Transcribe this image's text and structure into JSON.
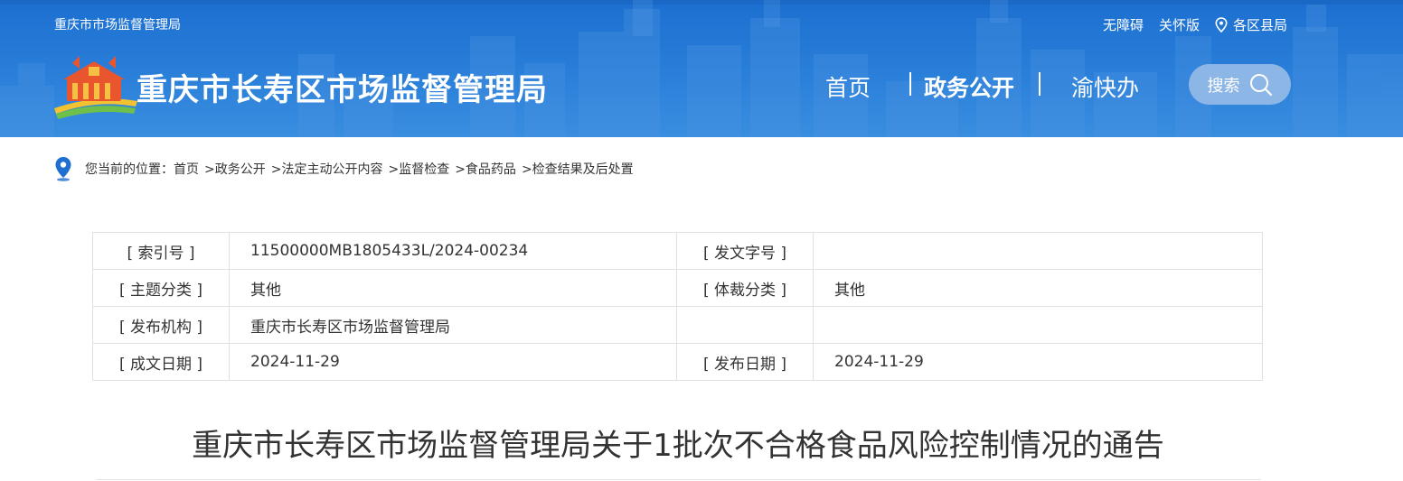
{
  "header": {
    "org_top": "重庆市市场监督管理局",
    "accessibility": "无障碍",
    "care_mode": "关怀版",
    "districts": "各区县局",
    "site_title": "重庆市长寿区市场监督管理局",
    "nav": {
      "home": "首页",
      "gov_open": "政务公开",
      "yu_kuai_ban": "渝快办"
    },
    "search_label": "搜索",
    "colors": {
      "banner": "#2a7fd9",
      "search_bg": "#8cb6e6"
    }
  },
  "breadcrumb": {
    "prefix": "您当前的位置：",
    "items": [
      "首页",
      ">政务公开",
      ">法定主动公开内容",
      ">监督检查",
      ">食品药品",
      ">检查结果及后处置"
    ]
  },
  "meta": {
    "rows": [
      {
        "l1": "[ 索引号 ]",
        "v1": "11500000MB1805433L/2024-00234",
        "l2": "[ 发文字号 ]",
        "v2": ""
      },
      {
        "l1": "[ 主题分类 ]",
        "v1": "其他",
        "l2": "[ 体裁分类 ]",
        "v2": "其他"
      },
      {
        "l1": "[ 发布机构 ]",
        "v1": "重庆市长寿区市场监督管理局",
        "l2": "",
        "v2": ""
      },
      {
        "l1": "[ 成文日期 ]",
        "v1": "2024-11-29",
        "l2": "[ 发布日期 ]",
        "v2": "2024-11-29"
      }
    ]
  },
  "article": {
    "title": "重庆市长寿区市场监督管理局关于1批次不合格食品风险控制情况的通告"
  }
}
